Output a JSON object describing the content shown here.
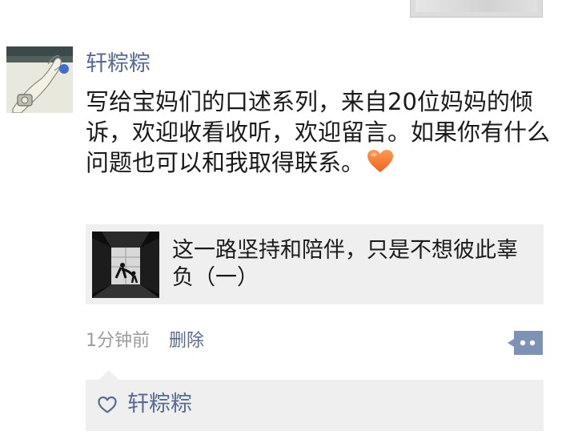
{
  "post": {
    "author": "轩粽粽",
    "text": "写给宝妈们的口述系列，来自20位妈妈的倾诉，欢迎收看收听，欢迎留言。如果你有什么问题也可以和我取得联系。",
    "emoji": "orange-heart-icon"
  },
  "link_card": {
    "title": "这一路坚持和陪伴，只是不想彼此辜负（一）"
  },
  "meta": {
    "time": "1分钟前",
    "delete_label": "删除"
  },
  "likes": {
    "names": [
      "轩粽粽"
    ]
  },
  "colors": {
    "link_blue": "#576b95",
    "card_bg": "#efefef",
    "meta_gray": "#9b9b9b",
    "heart_orange": "#f5793a"
  }
}
